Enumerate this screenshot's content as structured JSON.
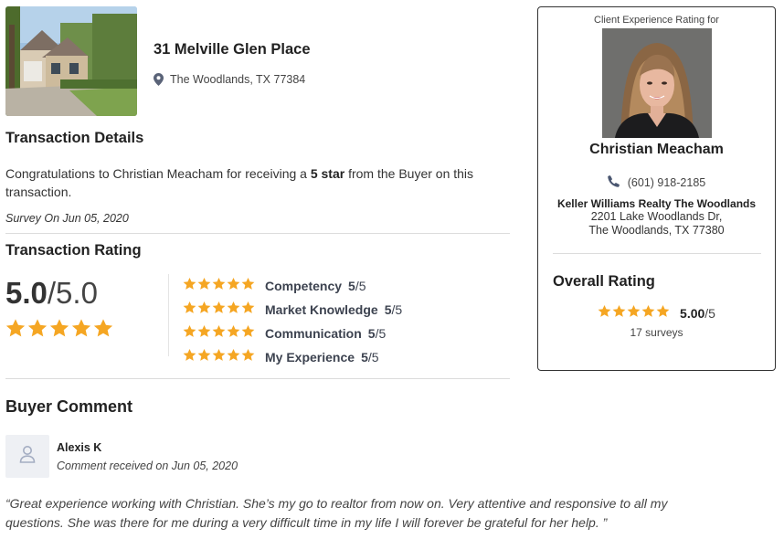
{
  "property": {
    "address": "31 Melville Glen Place",
    "city_line": "The Woodlands, TX 77384"
  },
  "transaction": {
    "heading": "Transaction Details",
    "congrats_before": "Congratulations to Christian Meacham for receiving a ",
    "congrats_strong": "5 star",
    "congrats_after": " from the Buyer on this transaction.",
    "survey_date": "Survey On Jun 05, 2020"
  },
  "rating": {
    "heading": "Transaction Rating",
    "score": "5.0",
    "out_of": "/5.0",
    "star_count": 5,
    "categories": [
      {
        "name": "Competency",
        "score": "5",
        "out_of": "/5"
      },
      {
        "name": "Market Knowledge",
        "score": "5",
        "out_of": "/5"
      },
      {
        "name": "Communication",
        "score": "5",
        "out_of": "/5"
      },
      {
        "name": "My Experience",
        "score": "5",
        "out_of": "/5"
      }
    ]
  },
  "comment": {
    "heading": "Buyer Comment",
    "author": "Alexis K",
    "date": "Comment received on Jun 05, 2020",
    "text": "“Great experience working with Christian. She’s my go to realtor from now on. Very attentive and responsive to all my questions. She was there for me during a very difficult time in my life I will forever be grateful for her help. ”"
  },
  "agent_card": {
    "header": "Client Experience Rating for",
    "name": "Christian Meacham",
    "phone": "(601) 918-2185",
    "brokerage": "Keller Williams Realty The Woodlands",
    "office_address_1": "2201 Lake Woodlands Dr,",
    "office_address_2": "The Woodlands, TX 77380",
    "overall_heading": "Overall Rating",
    "overall_score": "5.00",
    "overall_out_of": "/5",
    "survey_count": "17 surveys"
  },
  "icons": {
    "location": "map-pin-icon",
    "phone": "phone-icon",
    "star": "star-icon",
    "user": "user-icon"
  },
  "colors": {
    "star": "#f5a623",
    "pin": "#5a6378",
    "phone": "#4a5670",
    "text_dark": "#222222"
  }
}
